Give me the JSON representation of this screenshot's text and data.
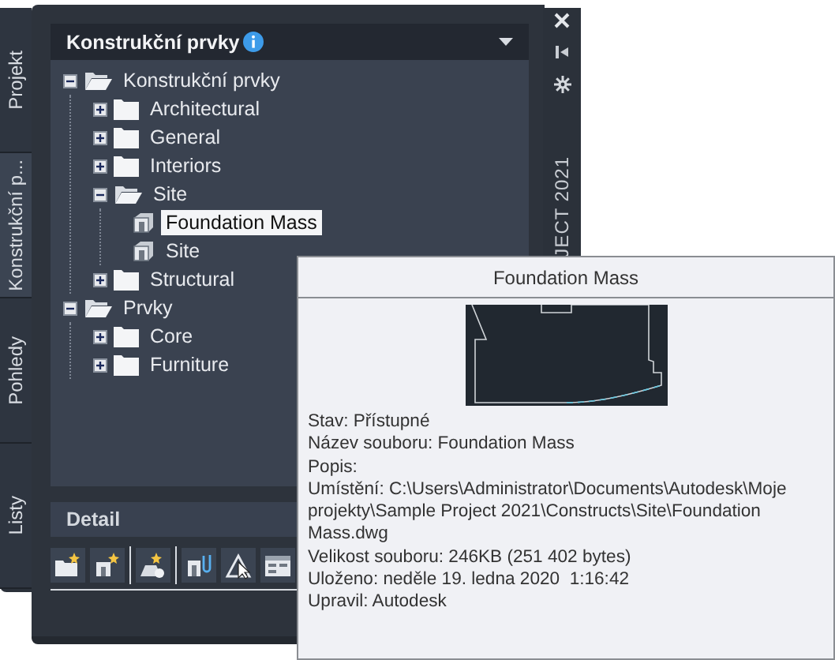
{
  "side_tabs": [
    {
      "label": "Projekt",
      "selected": false
    },
    {
      "label": "Konstrukční p...",
      "selected": true
    },
    {
      "label": "Pohledy",
      "selected": false
    },
    {
      "label": "Listy",
      "selected": false
    }
  ],
  "palette": {
    "title": "Konstrukční prvky",
    "tree": [
      {
        "label": "Konstrukční prvky",
        "kind": "folder",
        "expanded": true,
        "selected": false,
        "children": [
          {
            "label": "Architectural",
            "kind": "folder",
            "expanded": false,
            "selected": false
          },
          {
            "label": "General",
            "kind": "folder",
            "expanded": false,
            "selected": false
          },
          {
            "label": "Interiors",
            "kind": "folder",
            "expanded": false,
            "selected": false
          },
          {
            "label": "Site",
            "kind": "folder",
            "expanded": true,
            "selected": false,
            "children": [
              {
                "label": "Foundation Mass",
                "kind": "file",
                "selected": true
              },
              {
                "label": "Site",
                "kind": "file",
                "selected": false
              }
            ]
          },
          {
            "label": "Structural",
            "kind": "folder",
            "expanded": false,
            "selected": false
          }
        ]
      },
      {
        "label": "Prvky",
        "kind": "folder",
        "expanded": true,
        "selected": false,
        "children": [
          {
            "label": "Core",
            "kind": "folder",
            "expanded": false,
            "selected": false
          },
          {
            "label": "Furniture",
            "kind": "folder",
            "expanded": false,
            "selected": false
          }
        ]
      }
    ],
    "detail": "Detail"
  },
  "vertical_title": "JECT 2021",
  "tooltip": {
    "title": "Foundation Mass",
    "lines": [
      "Stav: Přístupné",
      "Název souboru: Foundation Mass",
      "Popis:",
      "Umístění: C:\\Users\\Administrator\\Documents\\Autodesk\\Moje projekty\\Sample Project 2021\\Constructs\\Site\\Foundation Mass.dwg",
      "Velikost souboru: 246KB (251 402 bytes)",
      "Uloženo: neděle 19. ledna 2020  1:16:42",
      "Upravil: Autodesk"
    ]
  }
}
